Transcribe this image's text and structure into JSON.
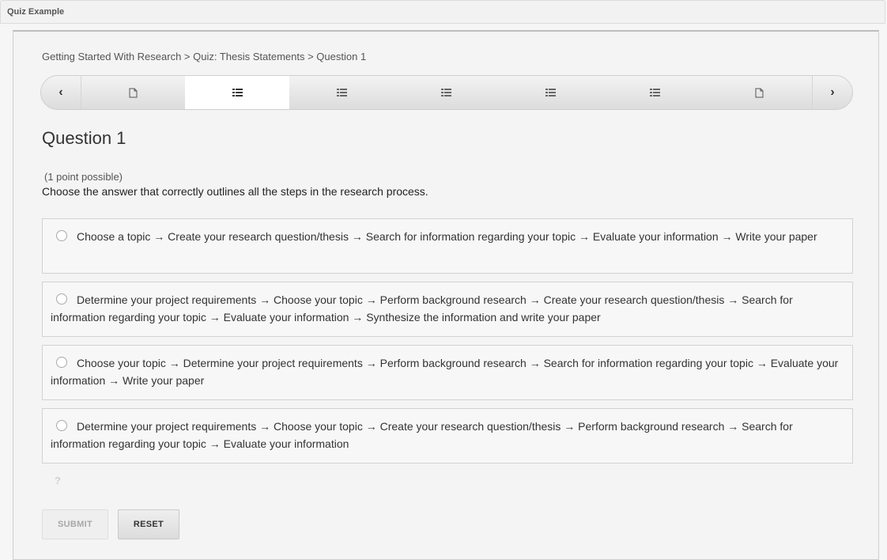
{
  "window": {
    "title": "Quiz Example"
  },
  "breadcrumb": "Getting Started With Research > Quiz: Thesis Statements > Question 1",
  "sequence_nav": {
    "prev_label": "‹",
    "next_label": "›",
    "items": [
      {
        "icon": "document-icon",
        "active": false
      },
      {
        "icon": "list-icon",
        "active": true
      },
      {
        "icon": "list-icon",
        "active": false
      },
      {
        "icon": "list-icon",
        "active": false
      },
      {
        "icon": "list-icon",
        "active": false
      },
      {
        "icon": "list-icon",
        "active": false
      },
      {
        "icon": "document-icon",
        "active": false
      }
    ]
  },
  "question": {
    "title": "Question 1",
    "points": "(1 point possible)",
    "prompt": "Choose the answer that correctly outlines all the steps in the research process.",
    "choices": [
      "Choose a topic → Create your research question/thesis → Search for information regarding your topic → Evaluate your information → Write your paper",
      "Determine your project requirements → Choose your topic → Perform background research → Create your research question/thesis → Search for information regarding your topic → Evaluate your information → Synthesize the information and write your paper",
      "Choose your topic → Determine your project requirements → Perform background research → Search for information regarding your topic → Evaluate your information → Write your paper",
      "Determine your project requirements → Choose your topic → Create your research question/thesis → Perform background research → Search for information regarding your topic → Evaluate your information"
    ],
    "help_label": "?"
  },
  "actions": {
    "submit_label": "SUBMIT",
    "reset_label": "RESET"
  },
  "colors": {
    "active_tab": "#ffffff",
    "nav_bar": "#e4e4e4",
    "disabled_text": "#a8a8a8"
  }
}
